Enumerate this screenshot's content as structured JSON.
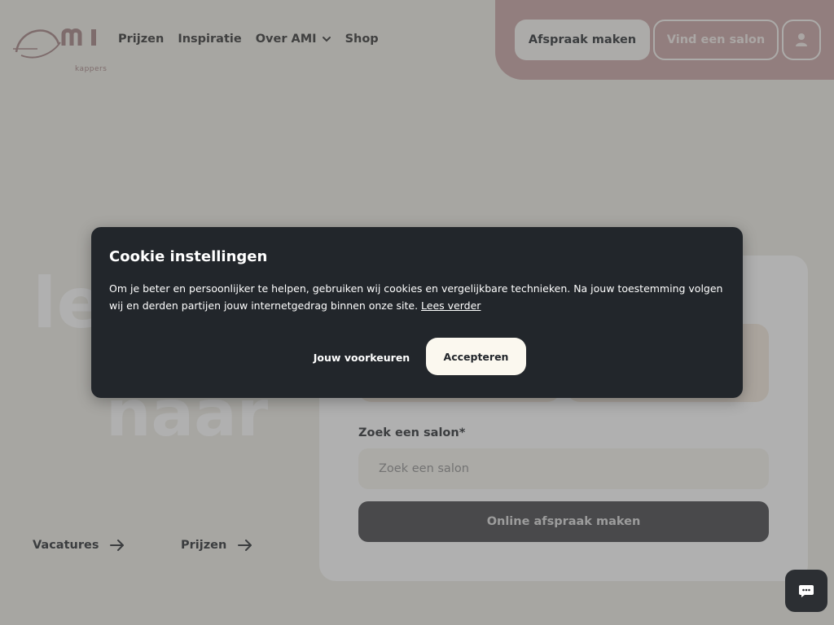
{
  "header": {
    "logo_text": "ami",
    "logo_sub": "kappers",
    "nav": [
      {
        "label": "Prijzen"
      },
      {
        "label": "Inspiratie"
      },
      {
        "label": "Over AMI"
      },
      {
        "label": "Shop"
      }
    ],
    "cta_appointment": "Afspraak maken",
    "cta_find_salon": "Vind een salon",
    "user_icon": "user-icon"
  },
  "hero": {
    "word1": "le",
    "word2": "naar",
    "links": [
      {
        "label": "Vacatures"
      },
      {
        "label": "Prijzen"
      }
    ]
  },
  "form": {
    "label": "Zoek een salon*",
    "input_value": "",
    "input_placeholder": "Zoek een salon",
    "submit_label": "Online afspraak maken"
  },
  "cookie": {
    "title": "Cookie instellingen",
    "body": "Om je beter en persoonlijker te helpen, gebruiken wij cookies en vergelijkbare technieken. Na jouw toestemming volgen wij en derden partijen jouw internetgedrag binnen onze site. ",
    "read_more": "Lees verder",
    "preferences_label": "Jouw voorkeuren",
    "accept_label": "Accepteren"
  },
  "chat_icon": "chat-bubble-icon",
  "colors": {
    "brand": "#c59f9f",
    "background": "#eeece4",
    "modal": "#22262b",
    "accent_tile": "#f3e9da"
  }
}
